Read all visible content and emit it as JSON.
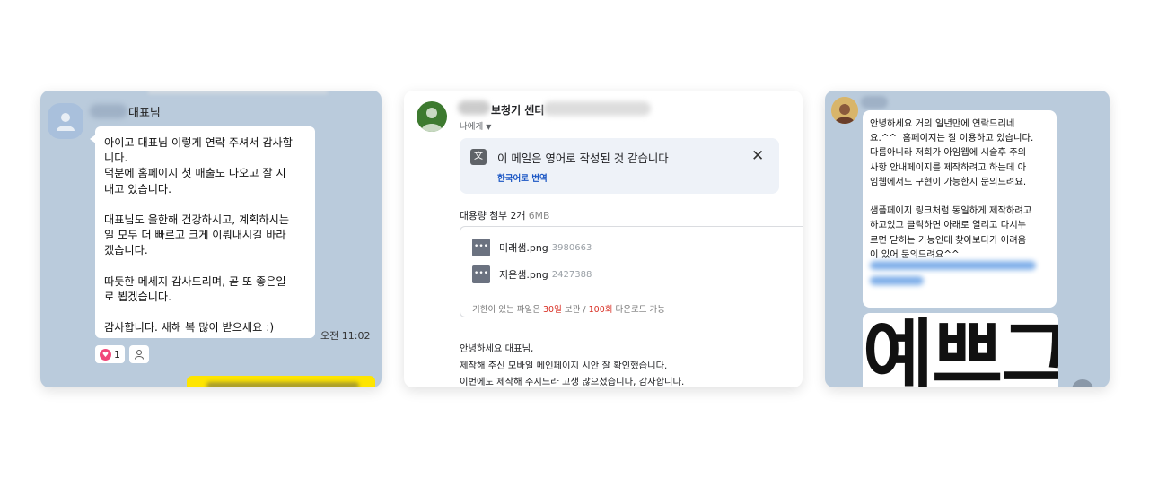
{
  "chat1": {
    "sender_suffix": "대표님",
    "message": "아이고 대표님 이렇게 연락 주셔서 감사합\n니다.\n덕분에 홈페이지 첫 매출도 나오고 잘 지\n내고 있습니다.\n\n대표님도 올한해 건강하시고, 계획하시는\n일 모두 더 빠르고 크게 이뤄내시길 바라\n겠습니다.\n\n따듯한 메세지 감사드리며, 곧 또 좋은일\n로 뵙겠습니다.\n\n감사합니다. 새해 복 많이 받으세요 :)",
    "time": "오전 11:02",
    "reaction_count": "1",
    "icons": {
      "avatar": "person-icon",
      "heart": "heart-icon",
      "reaction_user": "person-icon"
    }
  },
  "email": {
    "sender_name": "보청기 센터",
    "to_label": "나에게",
    "translate_title": "이 메일은 영어로 작성된 것 같습니다",
    "translate_link": "한국어로 번역",
    "attachments_title": "대용량 첨부 2개",
    "attachments_size": "6MB",
    "files": [
      {
        "name": "미래샘.png",
        "size": "3980663"
      },
      {
        "name": "지은샘.png",
        "size": "2427388"
      }
    ],
    "expire_prefix": "기한이 있는 파일은",
    "expire_days": "30일",
    "expire_mid": "보관 /",
    "expire_count": "100회",
    "expire_suffix": "다운로드 가능",
    "body": "안녕하세요 대표님,\n제작해 주신 모바일 메인페이지 시안 잘 확인했습니다.\n이번에도 제작해 주시느라 고생 많으셨습니다, 감사합니다.",
    "icons": {
      "translate": "translate-icon",
      "close": "close-icon",
      "file": "file-icon",
      "dropdown": "chevron-down-icon"
    }
  },
  "chat2": {
    "message": "안녕하세요 거의 일년만에 연락드리네\n요.^^  홈페이지는 잘 이용하고 있습니다.\n다름아니라 저희가 아임웹에 시술후 주의\n사항 안내페이지를 제작하려고 하는데 아\n임웹에서도 구현이 가능한지 문의드려요.\n\n샘플페이지 링크처럼 동일하게 제작하려고\n하고있고 클릭하면 아래로 열리고 다시누\n르면 닫히는 기능인데 찾아보다가 어려움\n이 있어 문의드려요^^",
    "image_text": "예쁘그",
    "colors": {
      "chat_bg": "#bacbdc",
      "bubble": "#ffffff",
      "kakao_yellow": "#fee500"
    }
  }
}
